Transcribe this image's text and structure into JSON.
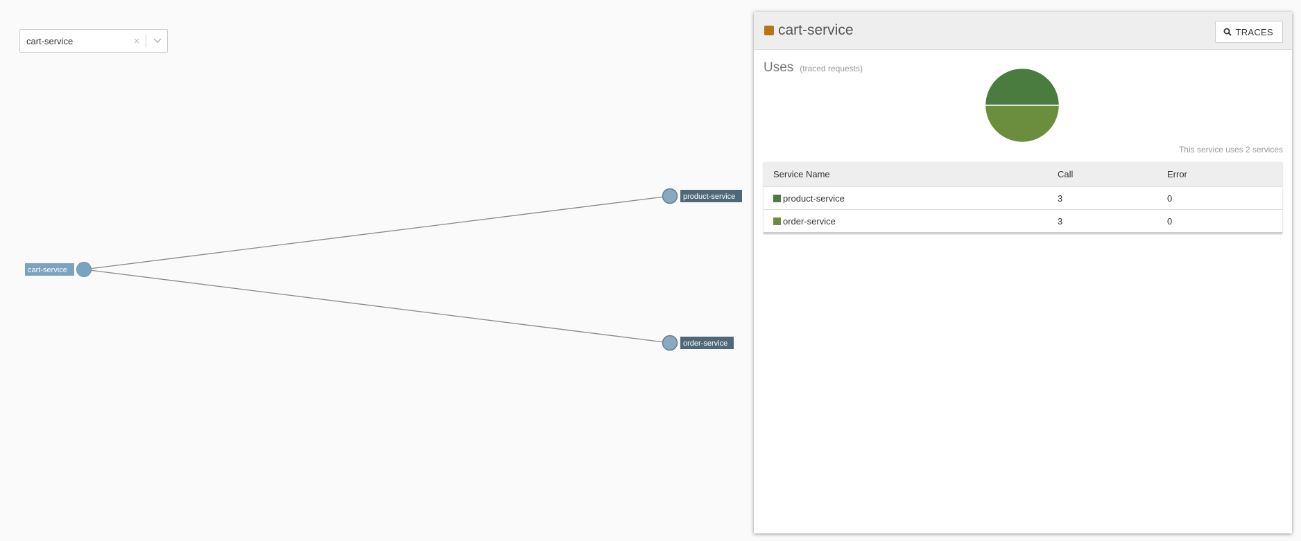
{
  "service_select": {
    "value": "cart-service",
    "clear_icon": "×"
  },
  "graph": {
    "source": {
      "label": "cart-service",
      "color": "#7ba3bf"
    },
    "targets": [
      {
        "label": "product-service",
        "color": "#8aa9bf"
      },
      {
        "label": "order-service",
        "color": "#8aa9bf"
      }
    ]
  },
  "panel": {
    "title": "cart-service",
    "swatch_color": "#b8741a",
    "traces_label": "TRACES",
    "uses_title": "Uses",
    "uses_subtitle": "(traced requests)",
    "summary": "This service uses 2 services",
    "table": {
      "headers": [
        "Service Name",
        "Call",
        "Error"
      ],
      "rows": [
        {
          "name": "product-service",
          "call": "3",
          "error": "0",
          "color": "#4a7c3f"
        },
        {
          "name": "order-service",
          "call": "3",
          "error": "0",
          "color": "#6b8e3e"
        }
      ]
    }
  },
  "chart_data": {
    "type": "pie",
    "categories": [
      "product-service",
      "order-service"
    ],
    "values": [
      3,
      3
    ],
    "colors": [
      "#4a7c3f",
      "#6b8e3e"
    ]
  }
}
